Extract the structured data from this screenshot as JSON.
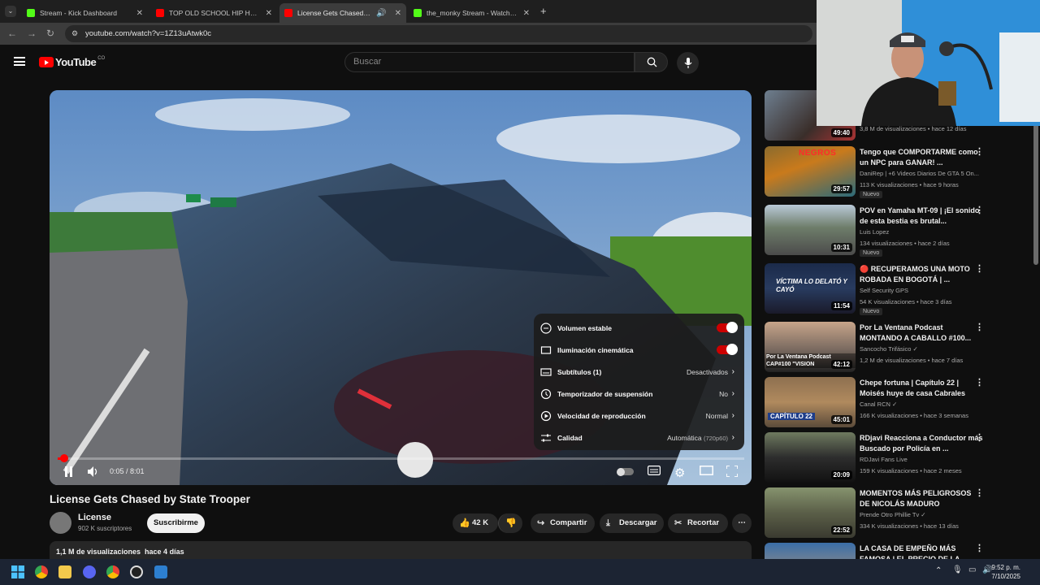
{
  "browser": {
    "tabs": [
      {
        "label": "Stream - Kick Dashboard",
        "color": "#53fc18"
      },
      {
        "label": "TOP OLD SCHOOL HIP HOP Ice",
        "color": "#ff0000"
      },
      {
        "label": "License Gets Chased by Stat",
        "color": "#ff0000"
      },
      {
        "label": "the_monky Stream - Watch Live",
        "color": "#53fc18"
      }
    ],
    "url": "youtube.com/watch?v=1Z13uAtwk0c"
  },
  "youtube": {
    "logo": "YouTube",
    "region": "CO",
    "search_placeholder": "Buscar"
  },
  "player": {
    "current_time": "0:05 / 8:01",
    "progress": 0.01,
    "settings": {
      "stable_volume": "Volumen estable",
      "ambient": "Iluminación cinemática",
      "subtitles": "Subtítulos (1)",
      "subtitles_value": "Desactivados",
      "sleep_timer": "Temporizador de suspensión",
      "sleep_timer_value": "No",
      "speed": "Velocidad de reproducción",
      "speed_value": "Normal",
      "quality": "Calidad",
      "quality_value": "Automática",
      "quality_res": "(720p60)"
    }
  },
  "video": {
    "title": "License Gets Chased by State Trooper",
    "channel": "License",
    "subscribers": "902 K suscriptores",
    "subscribe_label": "Suscribirme",
    "likes": "42 K",
    "share_label": "Compartir",
    "download_label": "Descargar",
    "clip_label": "Recortar",
    "views_date": "1,1 M de visualizaciones  hace 4 días"
  },
  "recommendations": [
    {
      "title": "",
      "channel": "",
      "meta": "3,8 M de visualizaciones • hace 12 días",
      "duration": "49:40",
      "badge": ""
    },
    {
      "title": "Tengo que COMPORTARME como un NPC para GANAR! ...",
      "channel": "DaniRep | +6 Videos Diarios De GTA 5 On...",
      "meta": "113 K visualizaciones • hace 9 horas",
      "duration": "29:57",
      "badge": "Nuevo"
    },
    {
      "title": "POV en Yamaha MT-09 | ¡El sonido de esta bestia es brutal...",
      "channel": "Luis Lopez",
      "meta": "134 visualizaciones • hace 2 días",
      "duration": "10:31",
      "badge": "Nuevo"
    },
    {
      "title": "🔴 RECUPERAMOS UNA MOTO ROBADA EN BOGOTÁ | ...",
      "channel": "Self Security GPS",
      "meta": "54 K visualizaciones • hace 3 días",
      "duration": "11:54",
      "badge": "Nuevo"
    },
    {
      "title": "Por La Ventana Podcast MONTANDO A CABALLO #100...",
      "channel": "Sancocho Trifásico ✓",
      "meta": "1,2 M de visualizaciones • hace 7 días",
      "duration": "42:12",
      "badge": ""
    },
    {
      "title": "Chepe fortuna | Capítulo 22 | Moisés huye de casa Cabrales",
      "channel": "Canal RCN ✓",
      "meta": "166 K visualizaciones • hace 3 semanas",
      "duration": "45:01",
      "badge": ""
    },
    {
      "title": "RDjavi Reacciona a Conductor más Buscado por Policía en ...",
      "channel": "RDJavi Fans Live",
      "meta": "159 K visualizaciones • hace 2 meses",
      "duration": "20:09",
      "badge": ""
    },
    {
      "title": "MOMENTOS MÁS PELIGROSOS DE NICOLÁS MADURO",
      "channel": "Prende Otro Phillie Tv ✓",
      "meta": "334 K visualizaciones • hace 13 días",
      "duration": "22:52",
      "badge": ""
    },
    {
      "title": "LA CASA DE EMPEÑO MÁS FAMOSA | EL PRECIO DE LA ...",
      "channel": "",
      "meta": "",
      "duration": "",
      "badge": ""
    }
  ],
  "thumb_text": {
    "rec1": "NEGROS",
    "rec3": "VÍCTIMA LO DELATÓ Y CAYÓ",
    "rec4": "Por La Ventana Podcast CAP#100 \"VISION",
    "rec5": "CAPÍTULO 22"
  },
  "taskbar": {
    "time": "9:52 p. m.",
    "date": "7/10/2025"
  }
}
